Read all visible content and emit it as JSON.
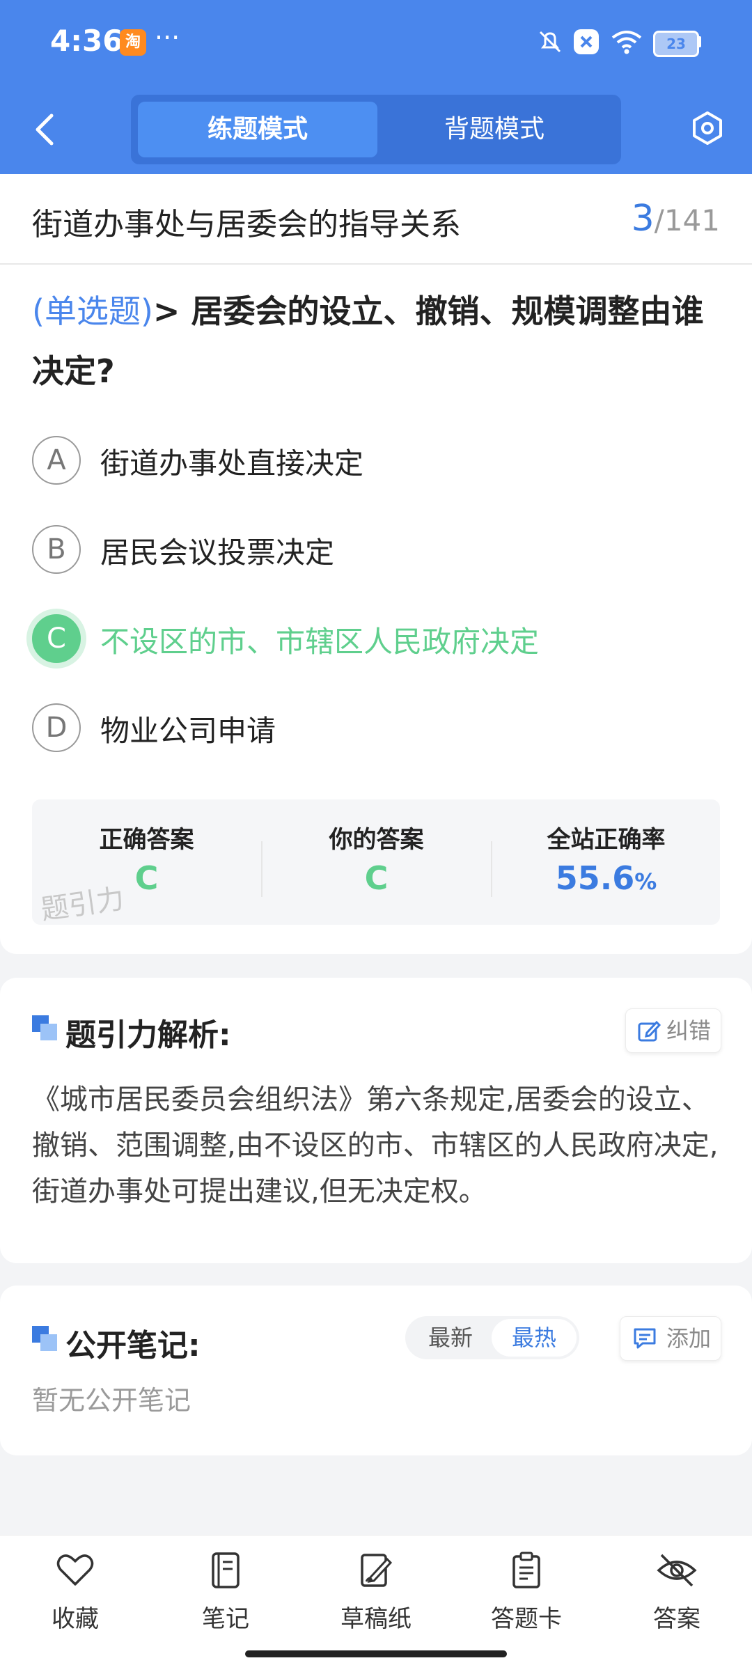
{
  "status_bar": {
    "time": "4:36",
    "app_badge": "淘",
    "more": "···",
    "battery": "23"
  },
  "header": {
    "tabs": [
      {
        "label": "练题模式",
        "active": true
      },
      {
        "label": "背题模式",
        "active": false
      }
    ],
    "accent_color": "#4a86ec"
  },
  "chapter": {
    "title": "街道办事处与居委会的指导关系",
    "current": "3",
    "total": "/141"
  },
  "question": {
    "type_label": "(单选题)",
    "separator": "> ",
    "text": "居委会的设立、撤销、规模调整由谁决定?",
    "options": [
      {
        "letter": "A",
        "text": "街道办事处直接决定",
        "correct": false
      },
      {
        "letter": "B",
        "text": "居民会议投票决定",
        "correct": false
      },
      {
        "letter": "C",
        "text": "不设区的市、市辖区人民政府决定",
        "correct": true
      },
      {
        "letter": "D",
        "text": "物业公司申请",
        "correct": false
      }
    ]
  },
  "answer_summary": {
    "correct_label": "正确答案",
    "correct_value": "C",
    "yours_label": "你的答案",
    "yours_value": "C",
    "rate_label": "全站正确率",
    "rate_value": "55.6",
    "rate_unit": "%",
    "watermark": "题引力"
  },
  "analysis": {
    "title": "题引力解析:",
    "correct_button": "纠错",
    "body": "《城市居民委员会组织法》第六条规定,居委会的设立、撤销、范围调整,由不设区的市、市辖区的人民政府决定,街道办事处可提出建议,但无决定权。"
  },
  "notes": {
    "title": "公开笔记:",
    "sort_options": [
      "最新",
      "最热"
    ],
    "add_button": "添加",
    "empty": "暂无公开笔记"
  },
  "bottom_nav": [
    {
      "label": "收藏",
      "icon": "heart-icon"
    },
    {
      "label": "笔记",
      "icon": "notebook-icon"
    },
    {
      "label": "草稿纸",
      "icon": "draft-icon"
    },
    {
      "label": "答题卡",
      "icon": "clipboard-icon"
    },
    {
      "label": "答案",
      "icon": "eye-off-icon"
    }
  ]
}
